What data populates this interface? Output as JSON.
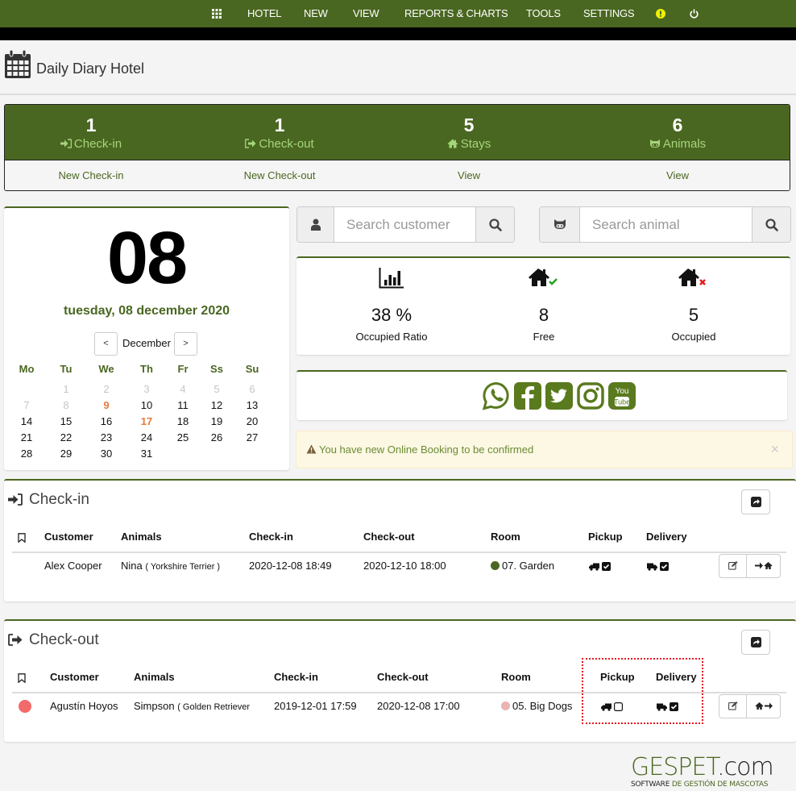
{
  "nav": {
    "items": [
      "HOTEL",
      "NEW",
      "VIEW",
      "REPORTS & CHARTS",
      "TOOLS",
      "SETTINGS"
    ],
    "alert_color": "#f0f000"
  },
  "header": {
    "title": "Daily Diary Hotel"
  },
  "stats": [
    {
      "count": "1",
      "label": "Check-in",
      "link": "New Check-in",
      "icon": "sign-in-icon"
    },
    {
      "count": "1",
      "label": "Check-out",
      "link": "New Check-out",
      "icon": "sign-out-icon"
    },
    {
      "count": "5",
      "label": "Stays",
      "link": "View",
      "icon": "home-icon"
    },
    {
      "count": "6",
      "label": "Animals",
      "link": "View",
      "icon": "animal-icon"
    }
  ],
  "calendar": {
    "day": "08",
    "full_date": "tuesday, 08 december 2020",
    "month": "December",
    "prev": "<",
    "next": ">",
    "weekdays": [
      "Mo",
      "Tu",
      "We",
      "Th",
      "Fr",
      "Ss",
      "Su"
    ],
    "weeks": [
      [
        null,
        {
          "d": "1",
          "t": "muted"
        },
        {
          "d": "2",
          "t": "muted"
        },
        {
          "d": "3",
          "t": "muted"
        },
        {
          "d": "4",
          "t": "muted"
        },
        {
          "d": "5",
          "t": "muted"
        },
        {
          "d": "6",
          "t": "muted"
        }
      ],
      [
        {
          "d": "7",
          "t": "muted"
        },
        {
          "d": "8",
          "t": "muted"
        },
        {
          "d": "9",
          "t": "hl"
        },
        {
          "d": "10"
        },
        {
          "d": "11"
        },
        {
          "d": "12"
        },
        {
          "d": "13"
        }
      ],
      [
        {
          "d": "14"
        },
        {
          "d": "15"
        },
        {
          "d": "16"
        },
        {
          "d": "17",
          "t": "hl"
        },
        {
          "d": "18"
        },
        {
          "d": "19"
        },
        {
          "d": "20"
        }
      ],
      [
        {
          "d": "21"
        },
        {
          "d": "22"
        },
        {
          "d": "23"
        },
        {
          "d": "24"
        },
        {
          "d": "25"
        },
        {
          "d": "26"
        },
        {
          "d": "27"
        }
      ],
      [
        {
          "d": "28"
        },
        {
          "d": "29"
        },
        {
          "d": "30"
        },
        {
          "d": "31"
        },
        null,
        null,
        null
      ]
    ]
  },
  "search": {
    "customer_placeholder": "Search customer",
    "animal_placeholder": "Search animal"
  },
  "occupancy": {
    "ratio": "38 %",
    "ratio_label": "Occupied Ratio",
    "free": "8",
    "free_label": "Free",
    "occupied": "5",
    "occupied_label": "Occupied"
  },
  "social": [
    "whatsapp",
    "facebook",
    "twitter",
    "instagram",
    "youtube"
  ],
  "alert": {
    "message": "You have new Online Booking to be confirmed",
    "close": "×"
  },
  "checkin": {
    "title": "Check-in",
    "columns": [
      "Customer",
      "Animals",
      "Check-in",
      "Check-out",
      "Room",
      "Pickup",
      "Delivery"
    ],
    "rows": [
      {
        "customer": "Alex Cooper",
        "animal": "Nina",
        "breed": "( Yorkshire Terrier )",
        "checkin": "2020-12-08 18:49",
        "checkout": "2020-12-10 18:00",
        "room": "07. Garden",
        "room_color": "#4a6721",
        "pickup": true,
        "delivery": true
      }
    ]
  },
  "checkout": {
    "title": "Check-out",
    "columns": [
      "Customer",
      "Animals",
      "Check-in",
      "Check-out",
      "Room",
      "Pickup",
      "Delivery"
    ],
    "rows": [
      {
        "status_color": "#f26a6a",
        "customer": "Agustín Hoyos",
        "animal": "Simpson",
        "breed": "( Golden Retriever",
        "checkin": "2019-12-01 17:59",
        "checkout": "2020-12-08 17:00",
        "room": "05. Big Dogs",
        "room_color": "#e8b4b4",
        "pickup": false,
        "delivery": true
      }
    ]
  },
  "logo": {
    "brand_green": "GESPET",
    "brand_dark": ".com",
    "tagline_dark": "SOFTWARE ",
    "tagline_green": "DE GESTIÓN DE MASCOTAS"
  },
  "colors": {
    "brand": "#4a6721",
    "brand_light": "#a4d67a",
    "highlight": "#e8793b",
    "alert_bg": "#fcf8e3"
  }
}
